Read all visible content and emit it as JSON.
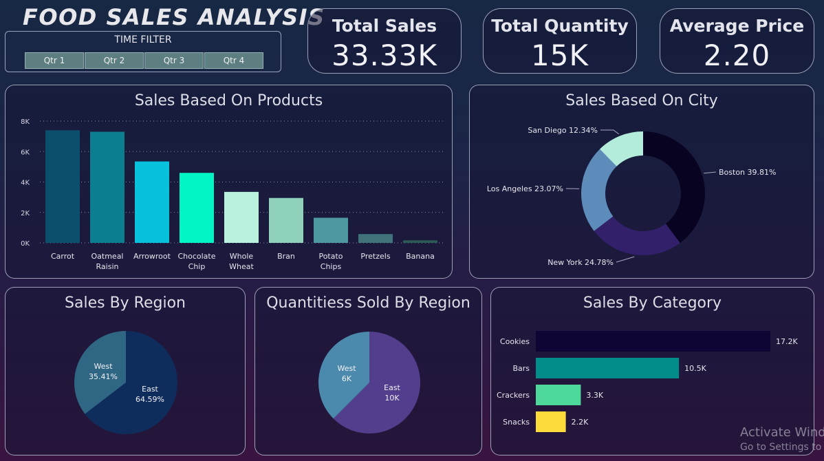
{
  "title": "FOOD SALES ANALYSIS",
  "time_filter": {
    "label": "TIME FILTER",
    "options": [
      "Qtr 1",
      "Qtr 2",
      "Qtr 3",
      "Qtr 4"
    ]
  },
  "kpis": [
    {
      "label": "Total Sales",
      "value": "33.33K"
    },
    {
      "label": "Total Quantity",
      "value": "15K"
    },
    {
      "label": "Average Price",
      "value": "2.20"
    }
  ],
  "colors": {
    "carrot": "#0b4f6c",
    "oatmeal": "#0b7f8f",
    "arrowroot": "#08c1dc",
    "chocolate": "#00f5c4",
    "whole_wheat": "#b9f0de",
    "bran": "#8fd1bb",
    "potato": "#4e99a0",
    "pretzels": "#3f7379",
    "banana": "#2c5a55"
  },
  "products_chart": {
    "title": "Sales Based On Products",
    "chart_data": {
      "type": "bar",
      "categories": [
        "Carrot",
        "Oatmeal Raisin",
        "Arrowroot",
        "Chocolate Chip",
        "Whole Wheat",
        "Bran",
        "Potato Chips",
        "Pretzels",
        "Banana"
      ],
      "category_lines": [
        [
          "Carrot"
        ],
        [
          "Oatmeal",
          "Raisin"
        ],
        [
          "Arrowroot"
        ],
        [
          "Chocolate",
          "Chip"
        ],
        [
          "Whole",
          "Wheat"
        ],
        [
          "Bran"
        ],
        [
          "Potato",
          "Chips"
        ],
        [
          "Pretzels"
        ],
        [
          "Banana"
        ]
      ],
      "values": [
        7400,
        7300,
        5350,
        4600,
        3350,
        2950,
        1650,
        580,
        170
      ],
      "colors": [
        "#0b4f6c",
        "#0b7f8f",
        "#08c1dc",
        "#00f5c4",
        "#b9f0de",
        "#8fd1bb",
        "#4e99a0",
        "#3f7379",
        "#2c5a55"
      ],
      "yticks": [
        "0K",
        "2K",
        "4K",
        "6K",
        "8K"
      ],
      "ylim": [
        0,
        8000
      ],
      "grid": true
    }
  },
  "city_chart": {
    "title": "Sales Based On City",
    "chart_data": {
      "type": "pie",
      "donut": true,
      "labels": [
        "Boston",
        "New York",
        "Los Angeles",
        "San Diego"
      ],
      "values": [
        39.81,
        24.78,
        23.07,
        12.34
      ],
      "display": [
        "Boston 39.81%",
        "New York 24.78%",
        "Los Angeles 23.07%",
        "San Diego 12.34%"
      ],
      "colors": [
        "#070320",
        "#33206a",
        "#5d8cba",
        "#b4ecdc"
      ]
    }
  },
  "region_sales_chart": {
    "title": "Sales By Region",
    "chart_data": {
      "type": "pie",
      "labels": [
        "East",
        "West"
      ],
      "values": [
        64.59,
        35.41
      ],
      "display": [
        "64.59%",
        "35.41%"
      ],
      "colors": [
        "#0f2d5c",
        "#2e6683"
      ]
    }
  },
  "region_qty_chart": {
    "title": "Quantitiess Sold By Region",
    "chart_data": {
      "type": "pie",
      "labels": [
        "East",
        "West"
      ],
      "values": [
        10,
        6
      ],
      "display": [
        "10K",
        "6K"
      ],
      "colors": [
        "#523e8c",
        "#4b89ad"
      ]
    }
  },
  "category_chart": {
    "title": "Sales By Category",
    "chart_data": {
      "type": "bar",
      "orientation": "horizontal",
      "categories": [
        "Cookies",
        "Bars",
        "Crackers",
        "Snacks"
      ],
      "values": [
        17200,
        10500,
        3300,
        2200
      ],
      "display": [
        "17.2K",
        "10.5K",
        "3.3K",
        "2.2K"
      ],
      "colors": [
        "#0f0535",
        "#028c8a",
        "#4fd89b",
        "#fddb3a"
      ]
    }
  },
  "watermark": {
    "line1": "Activate Wind",
    "line2": "Go to Settings to a"
  }
}
